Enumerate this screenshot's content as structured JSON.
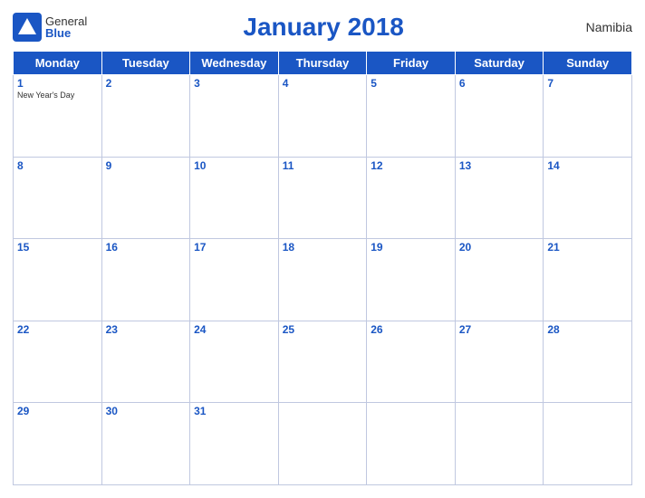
{
  "header": {
    "logo_general": "General",
    "logo_blue": "Blue",
    "title": "January 2018",
    "country": "Namibia"
  },
  "days_of_week": [
    "Monday",
    "Tuesday",
    "Wednesday",
    "Thursday",
    "Friday",
    "Saturday",
    "Sunday"
  ],
  "weeks": [
    [
      {
        "day": "1",
        "holiday": "New Year's Day"
      },
      {
        "day": "2"
      },
      {
        "day": "3"
      },
      {
        "day": "4"
      },
      {
        "day": "5"
      },
      {
        "day": "6"
      },
      {
        "day": "7"
      }
    ],
    [
      {
        "day": "8"
      },
      {
        "day": "9"
      },
      {
        "day": "10"
      },
      {
        "day": "11"
      },
      {
        "day": "12"
      },
      {
        "day": "13"
      },
      {
        "day": "14"
      }
    ],
    [
      {
        "day": "15"
      },
      {
        "day": "16"
      },
      {
        "day": "17"
      },
      {
        "day": "18"
      },
      {
        "day": "19"
      },
      {
        "day": "20"
      },
      {
        "day": "21"
      }
    ],
    [
      {
        "day": "22"
      },
      {
        "day": "23"
      },
      {
        "day": "24"
      },
      {
        "day": "25"
      },
      {
        "day": "26"
      },
      {
        "day": "27"
      },
      {
        "day": "28"
      }
    ],
    [
      {
        "day": "29"
      },
      {
        "day": "30"
      },
      {
        "day": "31"
      },
      {
        "day": ""
      },
      {
        "day": ""
      },
      {
        "day": ""
      },
      {
        "day": ""
      }
    ]
  ]
}
